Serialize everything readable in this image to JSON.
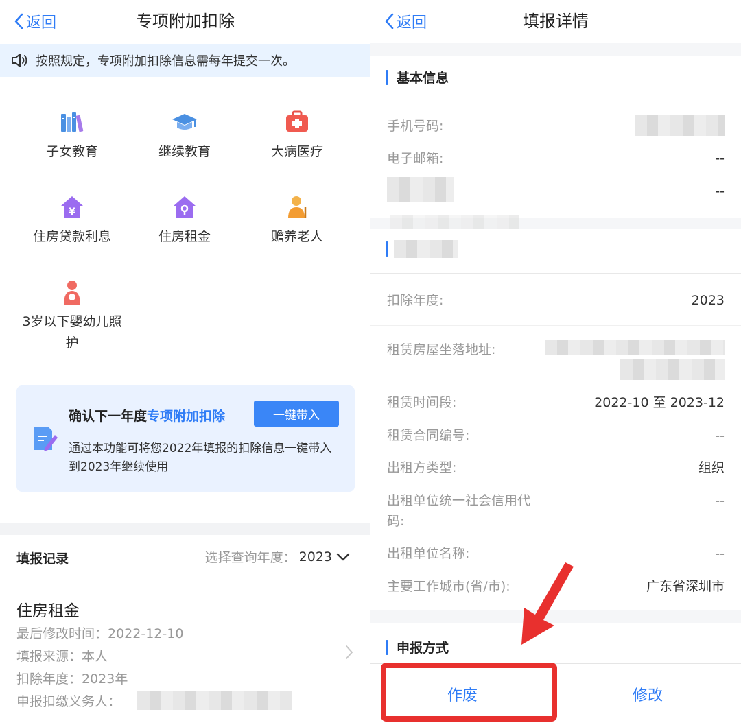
{
  "left": {
    "back_label": "返回",
    "title": "专项附加扣除",
    "notice": "按照规定，专项附加扣除信息需每年提交一次。",
    "categories": [
      {
        "label": "子女教育",
        "icon": "books-icon"
      },
      {
        "label": "继续教育",
        "icon": "graduation-cap-icon"
      },
      {
        "label": "大病医疗",
        "icon": "medical-kit-icon"
      },
      {
        "label": "住房贷款利息",
        "icon": "house-yuan-icon"
      },
      {
        "label": "住房租金",
        "icon": "house-key-icon"
      },
      {
        "label": "赡养老人",
        "icon": "elderly-person-icon"
      },
      {
        "label": "3岁以下婴幼儿照护",
        "icon": "mother-baby-icon"
      }
    ],
    "promo": {
      "title_prefix": "确认下一年度",
      "title_highlight": "专项附加扣除",
      "button": "一键带入",
      "desc": "通过本功能可将您2022年填报的扣除信息一键带入到2023年继续使用"
    },
    "records": {
      "title": "填报记录",
      "year_select_label": "选择查询年度：",
      "year_selected": "2023",
      "items": [
        {
          "title": "住房租金",
          "modified": "最后修改时间：2022-12-10",
          "source": "填报来源：本人",
          "year": "扣除年度：2023年",
          "withholder_label": "申报扣缴义务人："
        }
      ]
    }
  },
  "right": {
    "back_label": "返回",
    "title": "填报详情",
    "basic": {
      "heading": "基本信息",
      "rows": [
        {
          "label": "手机号码:",
          "value": ""
        },
        {
          "label": "电子邮箱:",
          "value": "--"
        },
        {
          "label": "",
          "value": "--"
        }
      ]
    },
    "housing": {
      "heading": "",
      "rows": [
        {
          "label": "扣除年度:",
          "value": "2023"
        },
        {
          "label": "租赁房屋坐落地址:",
          "value": ""
        },
        {
          "label": "租赁时间段:",
          "value": "2022-10 至 2023-12"
        },
        {
          "label": "租赁合同编号:",
          "value": "--"
        },
        {
          "label": "出租方类型:",
          "value": "组织"
        },
        {
          "label": "出租单位统一社会信用代码:",
          "value": "--"
        },
        {
          "label": "出租单位名称:",
          "value": "--"
        },
        {
          "label": "主要工作城市(省/市):",
          "value": "广东省深圳市"
        }
      ]
    },
    "declare": {
      "heading": "申报方式"
    },
    "actions": {
      "void": "作废",
      "edit": "修改"
    },
    "colors": {
      "accent": "#2f7cf6",
      "highlight": "#e8302e"
    }
  }
}
